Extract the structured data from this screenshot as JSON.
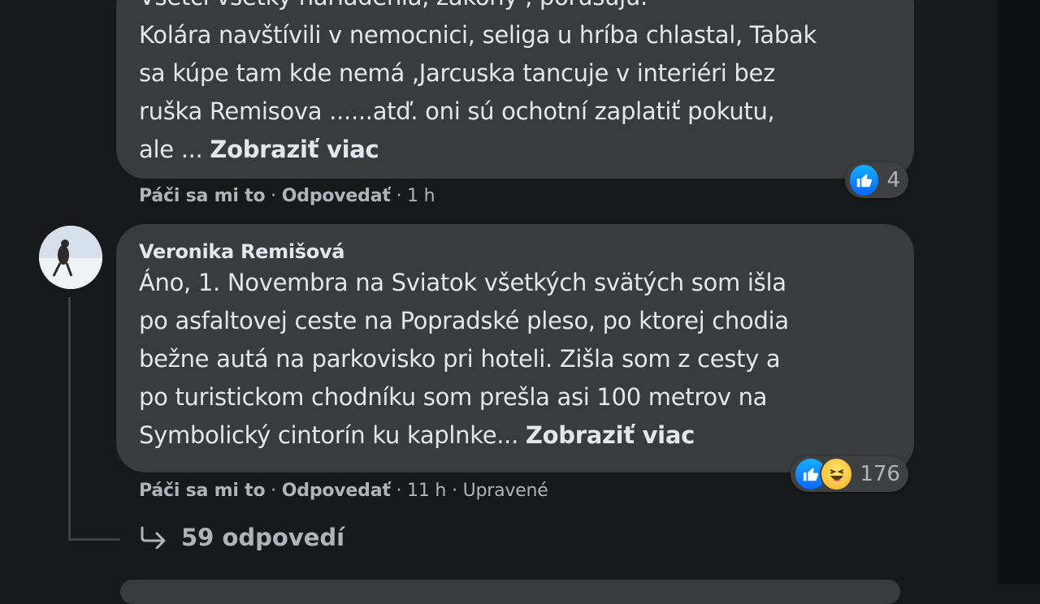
{
  "comment1": {
    "partial_first_line": "Všetci všetky nariadenia, zákony , porušujú.",
    "lines": [
      "Kolára navštívili v nemocnici, seliga u hríba chlastal, Tabak",
      "sa kúpe tam kde nemá ,Jarcuska tancuje v interiéri bez",
      "ruška Remisova ......atď. oni sú ochotní zaplatiť pokutu,"
    ],
    "last_line": "ale ... ",
    "see_more": "Zobraziť viac",
    "reaction_count": "4",
    "reaction_icon": "like-icon",
    "actions": {
      "like": "Páči sa mi to",
      "sep1": " · ",
      "reply": "Odpovedať",
      "sep2": " · ",
      "time": "1 h"
    }
  },
  "comment2": {
    "author": "Veronika Remišová",
    "lines": [
      "Áno, 1. Novembra na Sviatok všetkých svätých som išla",
      "po asfaltovej ceste na Popradské pleso, po ktorej chodia",
      "bežne autá na parkovisko pri hoteli. Zišla som z cesty a",
      "po turistickom chodníku som prešla asi 100 metrov na"
    ],
    "last_line": "Symbolický cintorín ku kaplnke... ",
    "see_more": "Zobraziť viac",
    "reaction_count": "176",
    "reaction_icons": [
      "like-icon",
      "haha-icon"
    ],
    "actions": {
      "like": "Páči sa mi to",
      "sep1": " · ",
      "reply": "Odpovedať",
      "sep2": " · ",
      "time": "11 h",
      "sep3": " · ",
      "edited": "Upravené"
    }
  },
  "replies": {
    "icon": "reply-arrow-icon",
    "label": "59 odpovedí"
  },
  "colors": {
    "background": "#18191a",
    "bubble": "#3a3b3c",
    "secondary_text": "#b0b3b8",
    "like_blue": "#0866ff"
  }
}
